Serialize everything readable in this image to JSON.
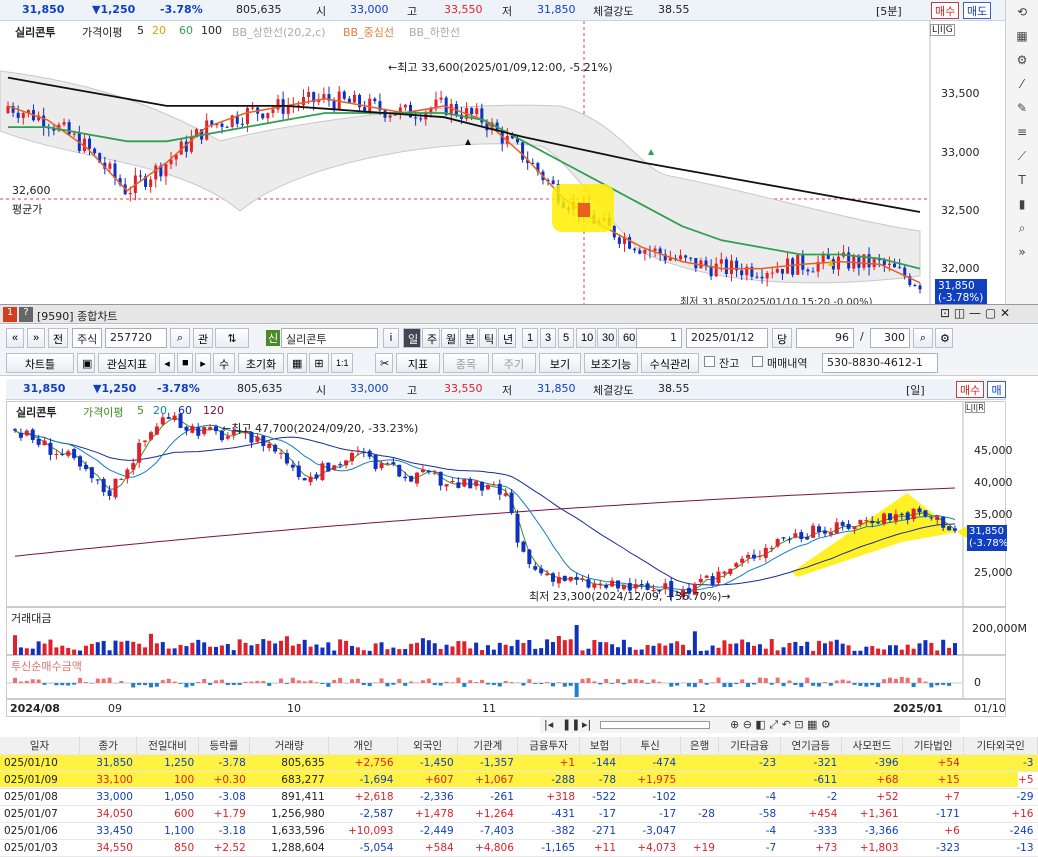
{
  "top_quote": {
    "price": "31,850",
    "change": "▼1,250",
    "rate": "-3.78%",
    "volume": "805,635",
    "open_label": "시",
    "open": "33,000",
    "high_label": "고",
    "high": "33,550",
    "low_label": "저",
    "low": "31,850",
    "strength_label": "체결강도",
    "strength": "38.55",
    "period": "[5분]",
    "buy": "매수",
    "sell": "매도"
  },
  "top_chart": {
    "stock": "실리콘투",
    "legend": [
      "가격이평",
      "5",
      "20",
      "60",
      "100",
      "BB_상한선(20,2,c)",
      "BB_중심선",
      "BB_하한선"
    ],
    "max_note": "←최고 33,600(2025/01/09,12:00, -5.21%)",
    "avg_price": "32,600",
    "avg_label": "평균가",
    "y_ticks": [
      "33,500",
      "33,000",
      "32,500",
      "32,000"
    ],
    "price_tag": "31,850",
    "rate_tag": "(-3.78%)",
    "bottom_note": "최저 31,850(2025/01/10 15:20 -0.00%)",
    "mini": "L|I|G"
  },
  "window": {
    "num1": "1",
    "num2": "?",
    "title": "[9590] 종합차트"
  },
  "toolbar1": {
    "prev": "«",
    "prev2": "»",
    "jeon": "전",
    "type": "주식",
    "code": "257720",
    "search": "⌕",
    "gwan": "관",
    "up": "⇅",
    "shin": "신",
    "name": "실리콘투",
    "info": "i",
    "periods": [
      "일",
      "주",
      "월",
      "분",
      "틱",
      "년"
    ],
    "nums": [
      "1",
      "3",
      "5",
      "10",
      "30",
      "60"
    ],
    "interval": "1",
    "date": "2025/01/12",
    "dang": "당",
    "count": "96",
    "total": "300"
  },
  "toolbar2": {
    "chart_type": "차트틀",
    "watch": "관심지표",
    "su": "수",
    "init": "초기화",
    "one": "1:1",
    "indicator": "지표",
    "stock_b": "종목",
    "cycle": "주기",
    "view": "보기",
    "assist": "보조기능",
    "manage": "수식관리",
    "balance": "잔고",
    "trade": "매매내역",
    "account": "530-8830-4612-1"
  },
  "mid_quote": {
    "price": "31,850",
    "change": "▼1,250",
    "rate": "-3.78%",
    "volume": "805,635",
    "open_label": "시",
    "open": "33,000",
    "high_label": "고",
    "high": "33,550",
    "low_label": "저",
    "low": "31,850",
    "strength_label": "체결강도",
    "strength": "38.55",
    "period": "[일]",
    "buy": "매수",
    "sell": "매도"
  },
  "main_chart": {
    "stock": "실리콘투",
    "legend": [
      "가격이평",
      "5",
      "20",
      "60",
      "120"
    ],
    "max_note": "←최고 47,700(2024/09/20, -33.23%)",
    "min_note": "최저 23,300(2024/12/09, +36.70%)→",
    "y_ticks": [
      "45,000",
      "40,000",
      "35,000",
      "30,000",
      "25,000"
    ],
    "price_tag": "31,850",
    "rate_tag": "(-3.78%)",
    "mini": "L|I|R"
  },
  "volume_pane": {
    "title": "거래대금",
    "tick": "200,000M"
  },
  "inst_pane": {
    "title": "투신순매수금액",
    "tick": "0"
  },
  "x_axis": {
    "labels": [
      "2024/08",
      "09",
      "10",
      "11",
      "12",
      "2025/01"
    ],
    "right": "01/10"
  },
  "table": {
    "headers": [
      "일자",
      "종가",
      "전일대비",
      "등락률",
      "거래량",
      "개인",
      "외국인",
      "기관계",
      "금융투자",
      "보험",
      "투신",
      "은행",
      "기타금융",
      "연기금등",
      "사모펀드",
      "기타법인",
      "기타외국인"
    ],
    "rows": [
      [
        "025/01/10",
        "31,850",
        "1,250",
        "-3.78",
        "805,635",
        "+2,756",
        "-1,450",
        "-1,357",
        "+1",
        "-144",
        "-474",
        "",
        "-23",
        "-321",
        "-396",
        "+54",
        "-3"
      ],
      [
        "025/01/09",
        "33,100",
        "100",
        "+0.30",
        "683,277",
        "-1,694",
        "+607",
        "+1,067",
        "-288",
        "-78",
        "+1,975",
        "",
        "",
        "-611",
        "+68",
        "+15",
        "+5"
      ],
      [
        "025/01/08",
        "33,000",
        "1,050",
        "-3.08",
        "891,411",
        "+2,618",
        "-2,336",
        "-261",
        "+318",
        "-522",
        "-102",
        "",
        "-4",
        "-2",
        "+52",
        "+7",
        "-29"
      ],
      [
        "025/01/07",
        "34,050",
        "600",
        "+1.79",
        "1,256,980",
        "-2,587",
        "+1,478",
        "+1,264",
        "-431",
        "-17",
        "-17",
        "-28",
        "-58",
        "+454",
        "+1,361",
        "-171",
        "+16"
      ],
      [
        "025/01/06",
        "33,450",
        "1,100",
        "-3.18",
        "1,633,596",
        "+10,093",
        "-2,449",
        "-7,403",
        "-382",
        "-271",
        "-3,047",
        "",
        "-4",
        "-333",
        "-3,366",
        "+6",
        "-246"
      ],
      [
        "025/01/03",
        "34,550",
        "850",
        "+2.52",
        "1,288,604",
        "-5,054",
        "+584",
        "+4,806",
        "-1,165",
        "+11",
        "+4,073",
        "+19",
        "-7",
        "+73",
        "+1,803",
        "-323",
        "-13"
      ]
    ]
  },
  "chart_data": [
    {
      "type": "line",
      "title": "실리콘투",
      "series": [
        {
          "name": "5",
          "values": [
            33200,
            33100,
            32900,
            32600,
            32800,
            33050,
            33150,
            33200,
            33250,
            33200,
            33150,
            33200,
            33100,
            32850,
            32550,
            32350,
            32200,
            32100,
            32050,
            32050,
            32080,
            32100,
            32080,
            31950
          ]
        },
        {
          "name": "20",
          "values": [
            33050,
            33050,
            33000,
            32950,
            32950,
            33000,
            33050,
            33100,
            33150,
            33150,
            33150,
            33150,
            33100,
            32950,
            32800,
            32650,
            32500,
            32350,
            32250,
            32200,
            32150,
            32150,
            32120,
            32050
          ]
        },
        {
          "name": "100",
          "values": [
            33400,
            33350,
            33300,
            33250,
            33200,
            33200,
            33200,
            33200,
            33180,
            33160,
            33140,
            33120,
            33050,
            32980,
            32920,
            32860,
            32800,
            32750,
            32700,
            32650,
            32600,
            32550,
            32500,
            32450
          ]
        }
      ],
      "ylim": [
        31800,
        33800
      ],
      "annotations": [
        "최고 33,600(2025/01/09,12:00, -5.21%)",
        "32,600 평균가"
      ]
    },
    {
      "type": "bar",
      "title": "실리콘투",
      "categories": [
        "2024/08",
        "09",
        "10",
        "11",
        "12",
        "2025/01"
      ],
      "series": [
        {
          "name": "종가",
          "values": [
            41000,
            44500,
            44000,
            39500,
            26000,
            31850
          ]
        }
      ],
      "ylim": [
        22000,
        48000
      ]
    }
  ]
}
